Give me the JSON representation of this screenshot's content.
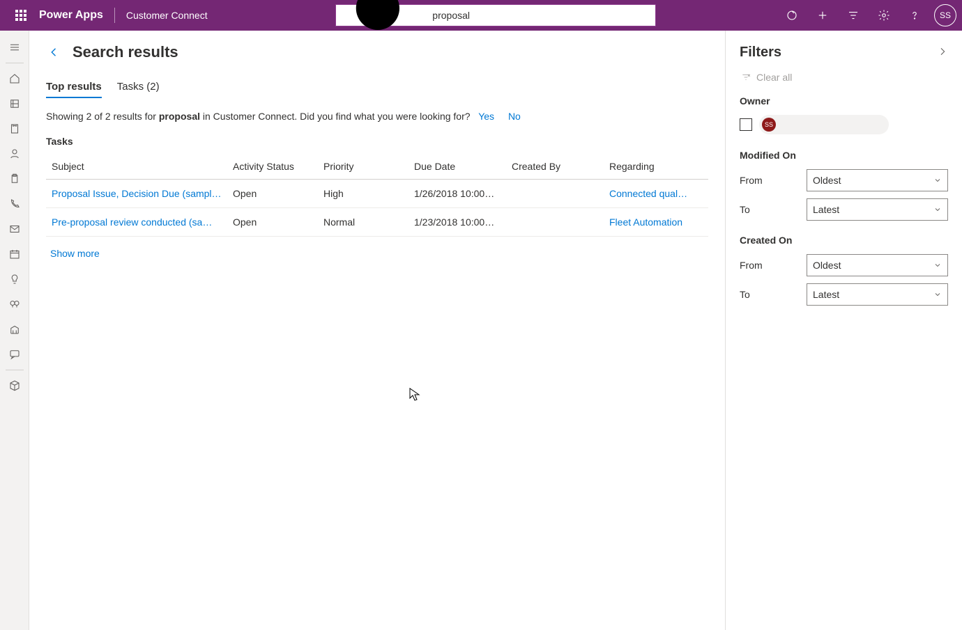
{
  "header": {
    "brand": "Power Apps",
    "app_name": "Customer Connect",
    "search_value": "proposal",
    "avatar_initials": "SS"
  },
  "page": {
    "title": "Search results",
    "tabs": [
      {
        "label": "Top results",
        "active": true
      },
      {
        "label": "Tasks (2)",
        "active": false
      }
    ],
    "summary": {
      "prefix": "Showing 2 of 2 results for ",
      "term": "proposal",
      "suffix": " in Customer Connect. Did you find what you were looking for?",
      "yes": "Yes",
      "no": "No"
    },
    "section_title": "Tasks",
    "columns": [
      "Subject",
      "Activity Status",
      "Priority",
      "Due Date",
      "Created By",
      "Regarding"
    ],
    "rows": [
      {
        "subject": "Proposal Issue, Decision Due (sampl…",
        "status": "Open",
        "priority": "High",
        "due": "1/26/2018 10:00…",
        "created_by": "",
        "regarding": "Connected qual…"
      },
      {
        "subject": "Pre-proposal review conducted (sa…",
        "status": "Open",
        "priority": "Normal",
        "due": "1/23/2018 10:00…",
        "created_by": "",
        "regarding": "Fleet Automation"
      }
    ],
    "show_more": "Show more"
  },
  "filters": {
    "title": "Filters",
    "clear_all": "Clear all",
    "owner_label": "Owner",
    "owner_badge": "SS",
    "owner_name": " ",
    "modified_on_label": "Modified On",
    "created_on_label": "Created On",
    "from": "From",
    "to": "To",
    "oldest": "Oldest",
    "latest": "Latest"
  }
}
